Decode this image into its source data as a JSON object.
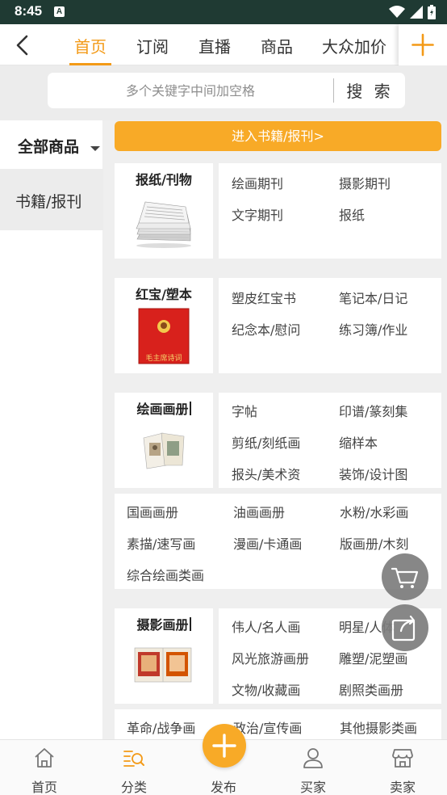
{
  "status_bar": {
    "time": "8:45",
    "notification_glyph": "A"
  },
  "top_nav": {
    "tabs": [
      "首页",
      "订阅",
      "直播",
      "商品",
      "大众加价"
    ],
    "active_tab_index": 0
  },
  "search": {
    "placeholder": "多个关键字中间加空格",
    "button_label": "搜 索"
  },
  "sidebar": {
    "all_label": "全部商品",
    "items": [
      {
        "label": "书籍/报刊",
        "selected": true
      }
    ]
  },
  "content": {
    "enter_button": "进入书籍/报刊>",
    "categories": [
      {
        "title": "报纸/刊物",
        "subcategories": [
          "绘画期刊",
          "摄影期刊",
          "文字期刊",
          "报纸"
        ],
        "extra": []
      },
      {
        "title": "红宝/塑本",
        "image_caption": "毛主席诗词",
        "subcategories": [
          "塑皮红宝书",
          "笔记本/日记",
          "纪念本/慰问",
          "练习簿/作业"
        ],
        "extra": []
      },
      {
        "title": "绘画画册",
        "subcategories": [
          "字帖",
          "印谱/篆刻集",
          "剪纸/刻纸画",
          "缩样本",
          "报头/美术资",
          "装饰/设计图"
        ],
        "extra": [
          "国画画册",
          "油画画册",
          "水粉/水彩画",
          "素描/速写画",
          "漫画/卡通画",
          "版画册/木刻",
          "综合绘画类画"
        ]
      },
      {
        "title": "摄影画册",
        "subcategories": [
          "伟人/名人画",
          "明星/人体",
          "风光旅游画册",
          "雕塑/泥塑画",
          "文物/收藏画",
          "剧照类画册"
        ],
        "extra": [
          "革命/战争画",
          "政治/宣传画",
          "其他摄影类画"
        ]
      }
    ]
  },
  "bottom_nav": {
    "items": [
      "首页",
      "分类",
      "发布",
      "买家",
      "卖家"
    ],
    "active_index": 1
  },
  "colors": {
    "accent": "#f39a17",
    "button_orange": "#f8aa27",
    "status_bar": "#1f3a33",
    "panel_bg": "#efefef"
  },
  "icons": [
    "back-arrow-icon",
    "plus-icon",
    "cart-icon",
    "share-icon",
    "home-icon",
    "category-search-icon",
    "user-icon",
    "shop-icon"
  ]
}
